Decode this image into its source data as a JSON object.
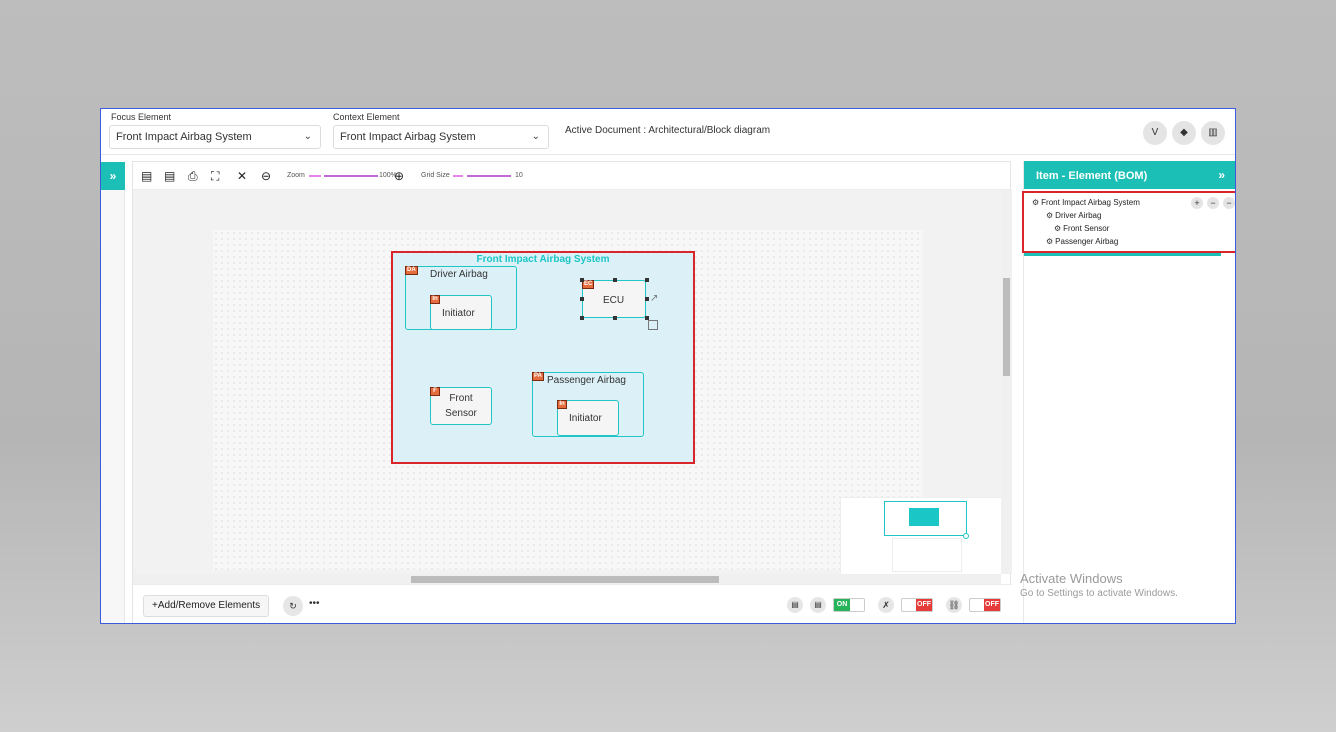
{
  "header": {
    "focus_label": "Focus Element",
    "focus_value": "Front Impact Airbag System",
    "context_label": "Context Element",
    "context_value": "Front Impact Airbag System",
    "active_doc": "Active Document : Architectural/Block diagram",
    "buttons": [
      {
        "icon": "v-icon",
        "glyph": "V"
      },
      {
        "icon": "drop-icon",
        "glyph": "◆"
      },
      {
        "icon": "chart-icon",
        "glyph": "▥"
      }
    ]
  },
  "toolbar": {
    "zoom_label": "Zoom",
    "zoom_value": "100%",
    "grid_label": "Grid Size",
    "grid_value": "10"
  },
  "diagram": {
    "system_title": "Front Impact Airbag System",
    "driver_airbag": {
      "tag": "DA",
      "label": "Driver Airbag"
    },
    "driver_initiator": {
      "tag": "In",
      "label": "Initiator"
    },
    "ecu": {
      "tag": "EC",
      "label": "ECU"
    },
    "front_sensor": {
      "tag": "F",
      "label_line1": "Front",
      "label_line2": "Sensor"
    },
    "passenger_airbag": {
      "tag": "PA",
      "label": "Passenger Airbag"
    },
    "passenger_initiator": {
      "tag": "In",
      "label": "Initiator"
    }
  },
  "bottom": {
    "add_label": "Add/Remove Elements",
    "toggle_on": "ON",
    "toggle_off1": "OFF",
    "toggle_off2": "OFF"
  },
  "right_panel": {
    "title": "Item - Element (BOM)",
    "tree": [
      "Front Impact Airbag System",
      "Driver Airbag",
      "Front Sensor",
      "Passenger Airbag"
    ]
  },
  "watermark": {
    "line1": "Activate Windows",
    "line2": "Go to Settings to activate Windows."
  },
  "colors": {
    "accent": "#1bbfb5",
    "highlight": "#d9262b",
    "tag": "#e56c3c"
  }
}
